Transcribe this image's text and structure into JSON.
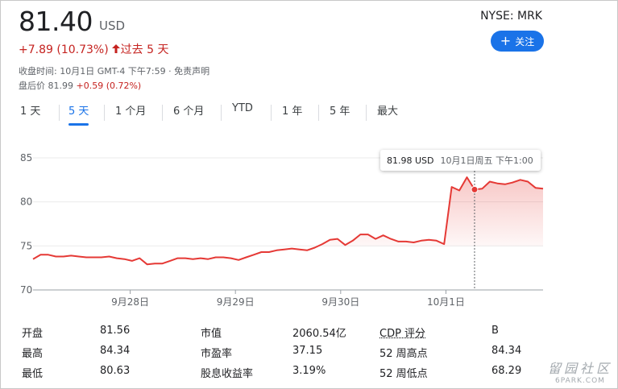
{
  "quote": {
    "price": "81.40",
    "currency": "USD",
    "change": "+7.89 (10.73%)",
    "period": "过去 5 天",
    "close_meta": "收盘时间: 10月1日 GMT-4 下午7:59 · 免责声明",
    "after_label": "盘后价 81.99 ",
    "after_change": "+0.59 (0.72%)",
    "ticker": "NYSE: MRK",
    "follow_label": "关注"
  },
  "tabs": [
    {
      "label": "1 天",
      "active": false
    },
    {
      "label": "5 天",
      "active": true
    },
    {
      "label": "1 个月",
      "active": false
    },
    {
      "label": "6 个月",
      "active": false
    },
    {
      "label": "YTD",
      "active": false
    },
    {
      "label": "1 年",
      "active": false
    },
    {
      "label": "5 年",
      "active": false
    },
    {
      "label": "最大",
      "active": false
    }
  ],
  "tooltip": {
    "price": "81.98 USD",
    "time": "10月1日周五 下午1:00"
  },
  "colors": {
    "down_red": "#c5221f",
    "line_red": "#e53935",
    "accent_blue": "#1a73e8"
  },
  "chart_data": {
    "type": "area",
    "ylim": [
      70,
      85
    ],
    "yticks": [
      "85",
      "80",
      "75",
      "70"
    ],
    "xticks": [
      "9月28日",
      "9月29日",
      "9月30日",
      "10月1日"
    ],
    "x_range": [
      0,
      63
    ],
    "xtick_positions": [
      12,
      25,
      38,
      51
    ],
    "baseline": 75,
    "marker_index": 58,
    "values": [
      73.5,
      74.0,
      74.0,
      73.8,
      73.8,
      73.9,
      73.8,
      73.7,
      73.7,
      73.7,
      73.8,
      73.6,
      73.5,
      73.3,
      73.6,
      72.9,
      73.0,
      73.0,
      73.3,
      73.6,
      73.6,
      73.5,
      73.6,
      73.5,
      73.7,
      73.7,
      73.6,
      73.4,
      73.7,
      74.0,
      74.3,
      74.3,
      74.5,
      74.6,
      74.7,
      74.6,
      74.5,
      74.8,
      75.2,
      75.7,
      75.8,
      75.1,
      75.6,
      76.3,
      76.3,
      75.8,
      76.2,
      75.8,
      75.5,
      75.5,
      75.4,
      75.6,
      75.7,
      75.6,
      75.2,
      81.7,
      81.3,
      82.8,
      81.4,
      81.5,
      82.3,
      82.1,
      82.0,
      82.2,
      82.5,
      82.3,
      81.6,
      81.5
    ]
  },
  "stats": [
    [
      {
        "label": "开盘",
        "value": "81.56"
      },
      {
        "label": "市值",
        "value": "2060.54亿"
      },
      {
        "label": "CDP 评分",
        "value": "B"
      }
    ],
    [
      {
        "label": "最高",
        "value": "84.34"
      },
      {
        "label": "市盈率",
        "value": "37.15"
      },
      {
        "label": "52 周高点",
        "value": "84.34"
      }
    ],
    [
      {
        "label": "最低",
        "value": "80.63"
      },
      {
        "label": "股息收益率",
        "value": "3.19%"
      },
      {
        "label": "52 周低点",
        "value": "68.29"
      }
    ]
  ],
  "watermark": {
    "line1": "留园社区",
    "line2": "6PARK.COM"
  }
}
